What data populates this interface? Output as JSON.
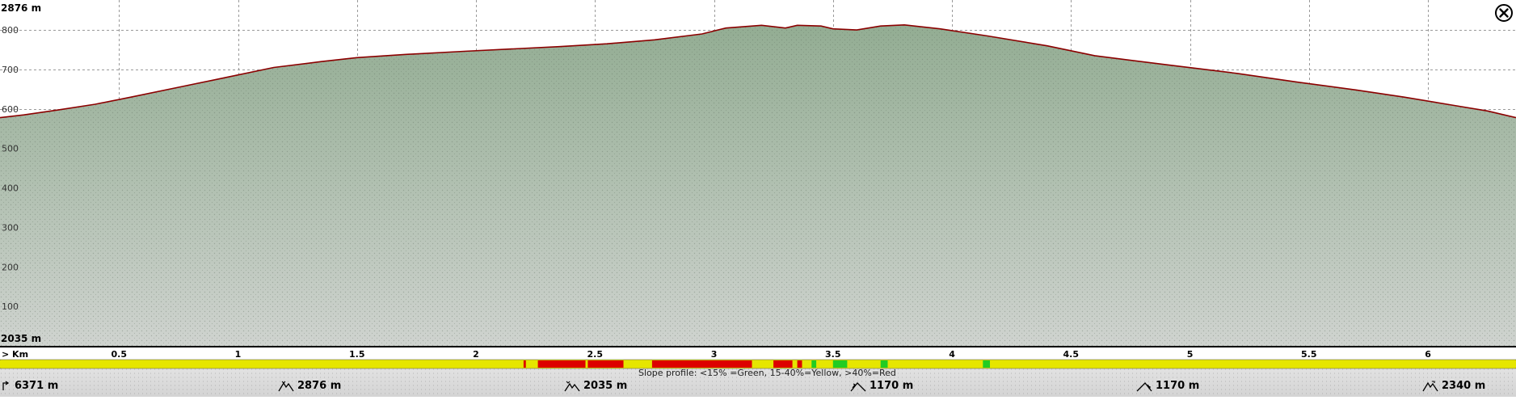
{
  "chart_data": {
    "type": "area",
    "y_top_label": "2876 m",
    "y_bottom_label": "2035 m",
    "x_axis_prefix": "> Km",
    "xlim": [
      0,
      6.37
    ],
    "ylim": [
      0,
      876
    ],
    "x_ticks": [
      "0.5",
      "1",
      "1.5",
      "2",
      "2.5",
      "3",
      "3.5",
      "4",
      "4.5",
      "5",
      "5.5",
      "6"
    ],
    "y_ticks": [
      "100",
      "200",
      "300",
      "400",
      "500",
      "600",
      "700",
      "800"
    ],
    "grid": true,
    "profile_color": "#8b0000",
    "fill_color": "#8fa98f",
    "x": [
      0,
      0.1,
      0.25,
      0.4,
      0.55,
      0.75,
      0.95,
      1.15,
      1.35,
      1.5,
      1.7,
      1.95,
      2.15,
      2.35,
      2.55,
      2.75,
      2.95,
      3.05,
      3.2,
      3.3,
      3.35,
      3.45,
      3.5,
      3.6,
      3.7,
      3.8,
      3.95,
      4.15,
      4.4,
      4.6,
      4.9,
      5.2,
      5.45,
      5.7,
      5.9,
      6.1,
      6.25,
      6.37
    ],
    "y": [
      578,
      585,
      598,
      612,
      630,
      655,
      680,
      705,
      720,
      730,
      738,
      746,
      752,
      758,
      765,
      775,
      790,
      805,
      812,
      805,
      812,
      810,
      803,
      800,
      810,
      813,
      803,
      785,
      760,
      735,
      712,
      690,
      668,
      648,
      630,
      610,
      595,
      578
    ],
    "slope_legend": "Slope profile: <15% =Green, 15-40%=Yellow, >40%=Red",
    "slope_colors": {
      "green": "#22cc22",
      "yellow": "#e6e600",
      "red": "#dd0000"
    },
    "slope_segments": [
      {
        "from": 0,
        "to": 2.2,
        "color": "yellow"
      },
      {
        "from": 2.2,
        "to": 2.21,
        "color": "red"
      },
      {
        "from": 2.21,
        "to": 2.26,
        "color": "yellow"
      },
      {
        "from": 2.26,
        "to": 2.46,
        "color": "red"
      },
      {
        "from": 2.46,
        "to": 2.47,
        "color": "yellow"
      },
      {
        "from": 2.47,
        "to": 2.62,
        "color": "red"
      },
      {
        "from": 2.62,
        "to": 2.74,
        "color": "yellow"
      },
      {
        "from": 2.74,
        "to": 3.16,
        "color": "red"
      },
      {
        "from": 3.16,
        "to": 3.25,
        "color": "yellow"
      },
      {
        "from": 3.25,
        "to": 3.33,
        "color": "red"
      },
      {
        "from": 3.33,
        "to": 3.35,
        "color": "yellow"
      },
      {
        "from": 3.35,
        "to": 3.37,
        "color": "red"
      },
      {
        "from": 3.37,
        "to": 3.41,
        "color": "yellow"
      },
      {
        "from": 3.41,
        "to": 3.43,
        "color": "green"
      },
      {
        "from": 3.43,
        "to": 3.5,
        "color": "yellow"
      },
      {
        "from": 3.5,
        "to": 3.56,
        "color": "green"
      },
      {
        "from": 3.56,
        "to": 3.7,
        "color": "yellow"
      },
      {
        "from": 3.7,
        "to": 3.73,
        "color": "green"
      },
      {
        "from": 3.73,
        "to": 4.13,
        "color": "yellow"
      },
      {
        "from": 4.13,
        "to": 4.16,
        "color": "green"
      },
      {
        "from": 4.16,
        "to": 6.37,
        "color": "yellow"
      }
    ]
  },
  "stats": {
    "distance": "6371 m",
    "max_elevation": "2876 m",
    "min_elevation": "2035 m",
    "ascent": "1170 m",
    "descent": "1170 m",
    "end_elevation": "2340 m"
  },
  "icons": {
    "close": "close-circle-icon",
    "distance": "distance-icon",
    "max": "mountain-peak-icon",
    "min": "valley-icon",
    "ascent": "ascent-icon",
    "descent": "descent-icon",
    "end": "end-elevation-icon"
  }
}
